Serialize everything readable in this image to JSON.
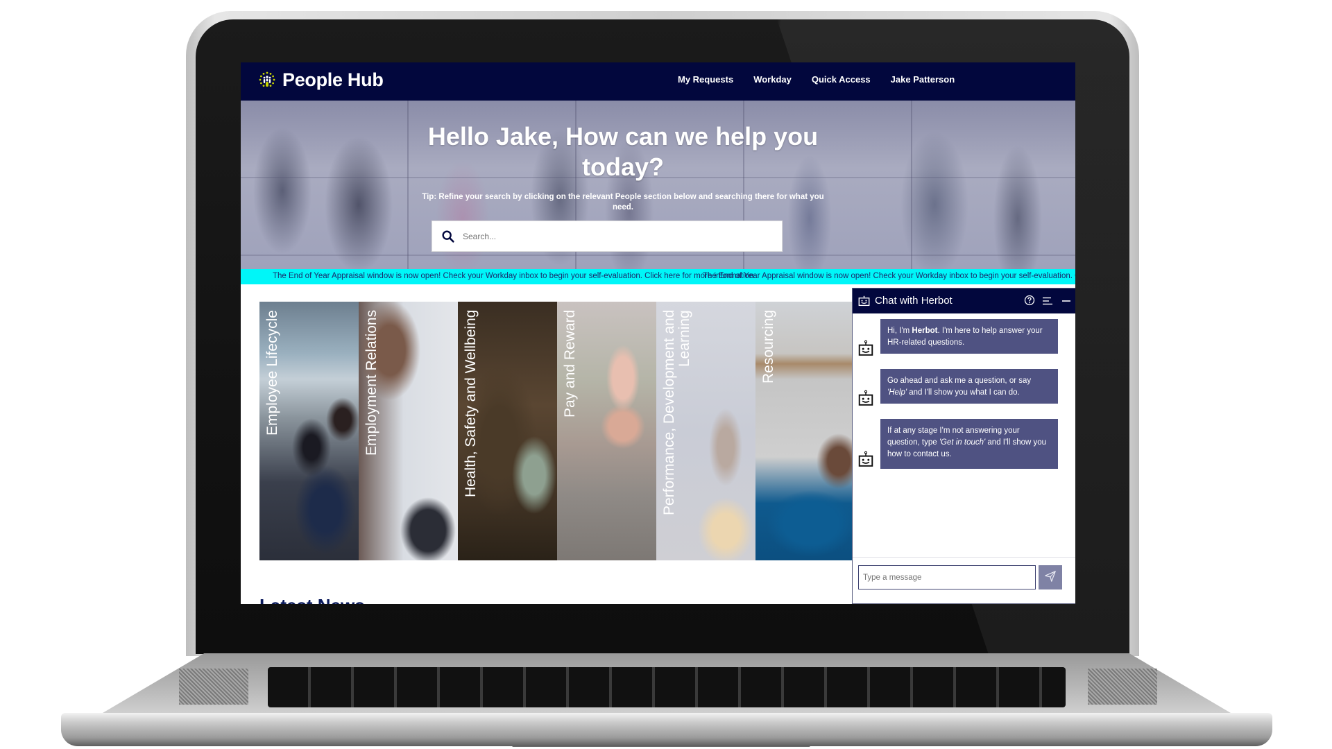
{
  "header": {
    "brand": "People Hub",
    "logo_icon": "people-hub-logo-icon",
    "nav": [
      {
        "label": "My Requests"
      },
      {
        "label": "Workday"
      },
      {
        "label": "Quick Access"
      },
      {
        "label": "Jake Patterson"
      }
    ]
  },
  "hero": {
    "title": "Hello Jake, How can we help you today?",
    "tip": "Tip: Refine your search by clicking on the relevant People section below and searching there for what you need.",
    "search": {
      "placeholder": "Search...",
      "value": "",
      "icon": "search-icon"
    }
  },
  "ticker": {
    "message": "The End of Year Appraisal window is now open! Check your Workday inbox to begin your self-evaluation. Click here for more information.",
    "background": "#00f6f8"
  },
  "tiles": [
    {
      "label": "Employee Lifecycle"
    },
    {
      "label": "Employment Relations"
    },
    {
      "label": "Health, Safety and Wellbeing"
    },
    {
      "label": "Pay and Reward"
    },
    {
      "label": "Performance, Development and Learning"
    },
    {
      "label": "Resourcing"
    }
  ],
  "latest_news": {
    "heading": "Latest News"
  },
  "chat": {
    "title": "Chat with Herbot",
    "header_icons": [
      "bot-icon",
      "help-icon",
      "menu-icon",
      "minimize-icon"
    ],
    "messages": [
      {
        "sender": "Herbot",
        "pre": "Hi, I'm ",
        "bold": "Herbot",
        "post": ". I'm here to help answer your HR-related questions."
      },
      {
        "sender": "Herbot",
        "pre": "Go ahead and ask me a question, or say ",
        "italic": "'Help'",
        "post": " and I'll show you what I can do."
      },
      {
        "sender": "Herbot",
        "pre": "If at any stage I'm not answering your question, type ",
        "italic": "'Get in touch'",
        "post": " and I'll show you how to contact us."
      }
    ],
    "input": {
      "placeholder": "Type a message",
      "value": ""
    },
    "send_icon": "send-icon"
  },
  "colors": {
    "nav_bg": "#02073d",
    "bubble_bg": "#4f5282",
    "send_btn": "#7f82a5",
    "news_heading": "#0a1a5c"
  }
}
